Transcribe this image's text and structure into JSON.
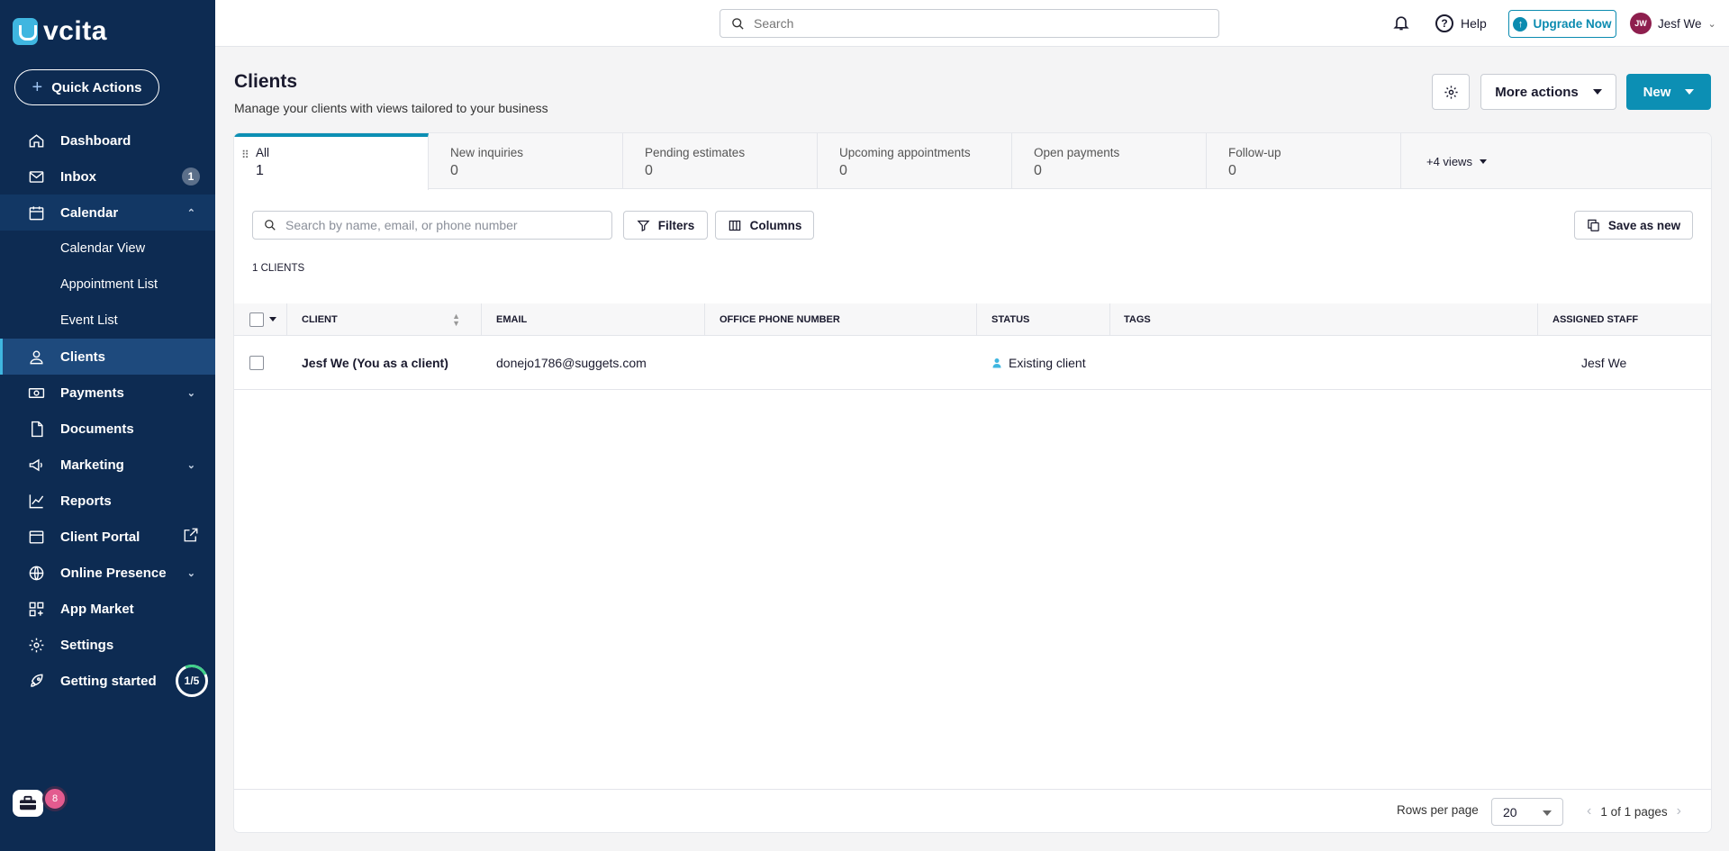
{
  "app": {
    "logo_text": "vcita"
  },
  "sidebar": {
    "quick_actions_label": "Quick Actions",
    "items": [
      {
        "label": "Dashboard",
        "icon": "home-icon"
      },
      {
        "label": "Inbox",
        "icon": "mail-icon",
        "badge": "1"
      },
      {
        "label": "Calendar",
        "icon": "calendar-icon",
        "expanded": true
      },
      {
        "label": "Calendar View"
      },
      {
        "label": "Appointment List"
      },
      {
        "label": "Event List"
      },
      {
        "label": "Clients",
        "icon": "user-icon",
        "active": true
      },
      {
        "label": "Payments",
        "icon": "payments-icon"
      },
      {
        "label": "Documents",
        "icon": "document-icon"
      },
      {
        "label": "Marketing",
        "icon": "megaphone-icon"
      },
      {
        "label": "Reports",
        "icon": "chart-icon"
      },
      {
        "label": "Client Portal",
        "icon": "portal-icon"
      },
      {
        "label": "Online Presence",
        "icon": "globe-icon"
      },
      {
        "label": "App Market",
        "icon": "apps-icon"
      },
      {
        "label": "Settings",
        "icon": "gear-icon"
      },
      {
        "label": "Getting started",
        "icon": "rocket-icon",
        "progress": "1/5"
      }
    ],
    "toolbox_badge": "8"
  },
  "topbar": {
    "search_placeholder": "Search",
    "help_label": "Help",
    "upgrade_label": "Upgrade Now",
    "user_initials": "JW",
    "user_name": "Jesf We"
  },
  "page": {
    "title": "Clients",
    "subtitle": "Manage your clients with views tailored to your business",
    "more_actions_label": "More actions",
    "new_label": "New"
  },
  "tabs": [
    {
      "label": "All",
      "count": "1",
      "active": true
    },
    {
      "label": "New inquiries",
      "count": "0"
    },
    {
      "label": "Pending estimates",
      "count": "0"
    },
    {
      "label": "Upcoming appointments",
      "count": "0"
    },
    {
      "label": "Open payments",
      "count": "0"
    },
    {
      "label": "Follow-up",
      "count": "0"
    }
  ],
  "more_views_label": "+4 views",
  "toolbar": {
    "search_placeholder": "Search by name, email, or phone number",
    "filters_label": "Filters",
    "columns_label": "Columns",
    "save_as_new_label": "Save as new",
    "count_label": "1 CLIENTS"
  },
  "table": {
    "columns": [
      "CLIENT",
      "EMAIL",
      "OFFICE PHONE NUMBER",
      "STATUS",
      "TAGS",
      "ASSIGNED STAFF"
    ],
    "rows": [
      {
        "client": "Jesf We (You as a client)",
        "email": "donejo1786@suggets.com",
        "phone": "",
        "status": "Existing client",
        "tags": "",
        "staff": "Jesf We"
      }
    ]
  },
  "pagination": {
    "rows_per_page_label": "Rows per page",
    "rows_per_page": "20",
    "page_info": "1 of 1 pages"
  },
  "colors": {
    "sidebar": "#0d2b52",
    "accent": "#0c8fb4",
    "status_icon": "#3fb6e0"
  }
}
